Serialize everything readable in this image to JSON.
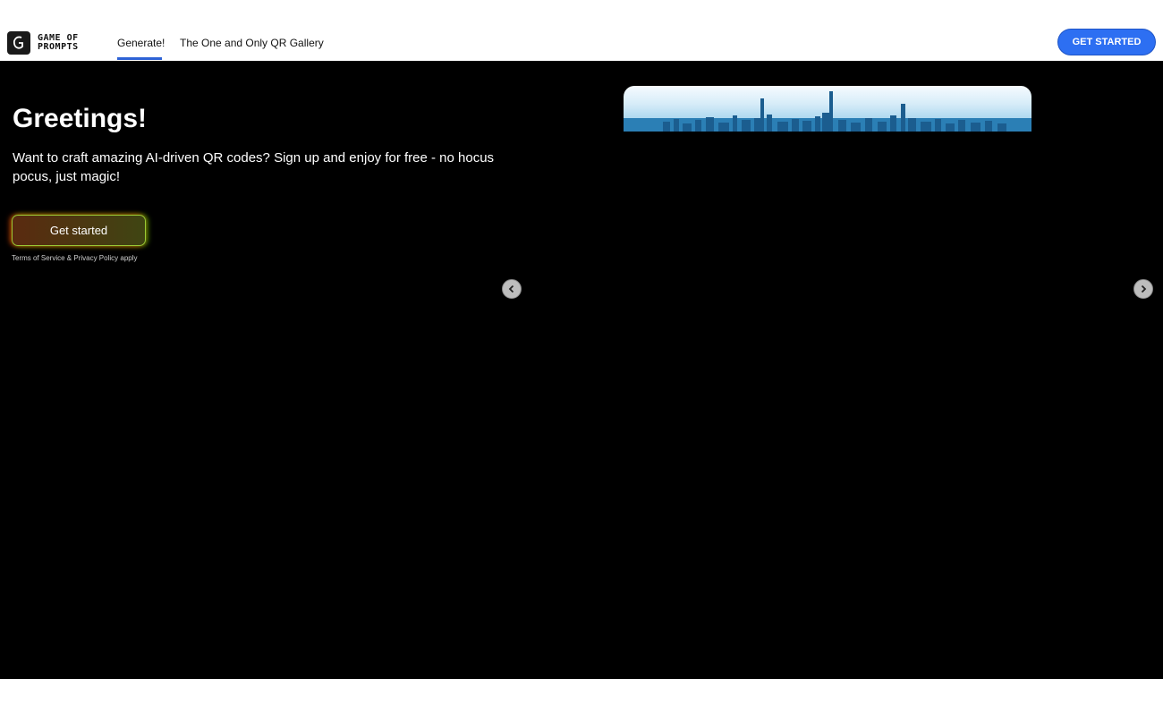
{
  "nav": {
    "logo_line1": "GAME OF",
    "logo_line2": "PROMPTS",
    "tabs": [
      {
        "label": "Generate!"
      },
      {
        "label": "The One and Only QR Gallery"
      }
    ],
    "cta_label": "GET STARTED"
  },
  "hero": {
    "title": "Greetings!",
    "subtitle": "Want to craft amazing AI-driven QR codes? Sign up and enjoy for free - no hocus pocus, just magic!",
    "button_label": "Get started",
    "terms": "Terms of Service & Privacy Policy apply"
  },
  "carousel": {
    "prev_icon": "chevron-left-icon",
    "next_icon": "chevron-right-icon"
  },
  "colors": {
    "accent": "#2d6ff2",
    "hero_bg": "#000000"
  }
}
